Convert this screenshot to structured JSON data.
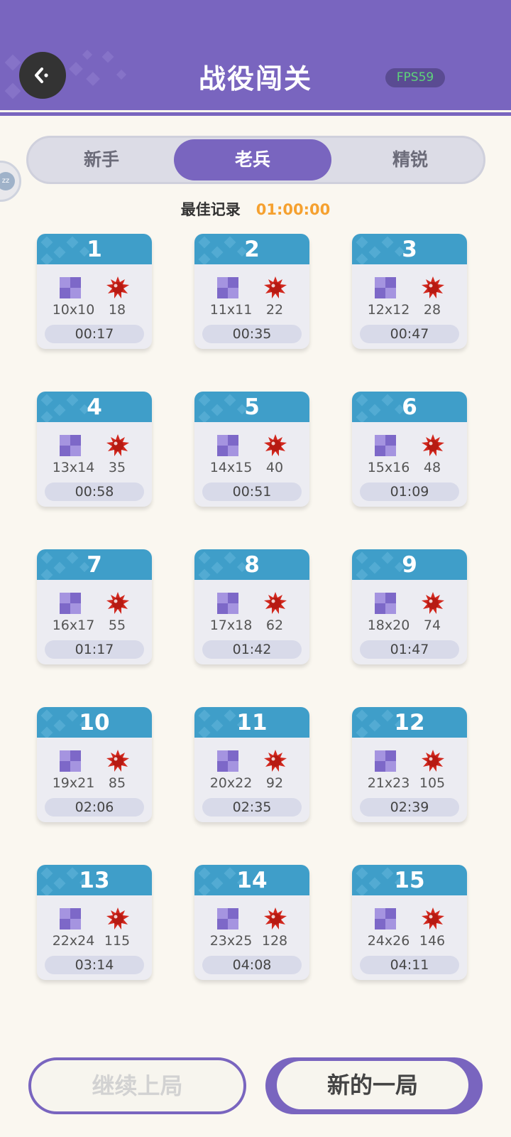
{
  "header": {
    "title": "战役闯关",
    "fps": "FPS59",
    "back_icon": "back-arrow-icon"
  },
  "colors": {
    "primary": "#7965bf",
    "card_header": "#3f9ec9",
    "best_time": "#f5a130",
    "fps_text": "#5ed37a",
    "mine": "#d1281e"
  },
  "tabs": [
    {
      "label": "新手",
      "active": false
    },
    {
      "label": "老兵",
      "active": true
    },
    {
      "label": "精锐",
      "active": false
    }
  ],
  "best": {
    "label": "最佳记录",
    "value": "01:00:00"
  },
  "levels": [
    {
      "num": "1",
      "size": "10x10",
      "mines": "18",
      "time": "00:17"
    },
    {
      "num": "2",
      "size": "11x11",
      "mines": "22",
      "time": "00:35"
    },
    {
      "num": "3",
      "size": "12x12",
      "mines": "28",
      "time": "00:47"
    },
    {
      "num": "4",
      "size": "13x14",
      "mines": "35",
      "time": "00:58"
    },
    {
      "num": "5",
      "size": "14x15",
      "mines": "40",
      "time": "00:51"
    },
    {
      "num": "6",
      "size": "15x16",
      "mines": "48",
      "time": "01:09"
    },
    {
      "num": "7",
      "size": "16x17",
      "mines": "55",
      "time": "01:17"
    },
    {
      "num": "8",
      "size": "17x18",
      "mines": "62",
      "time": "01:42"
    },
    {
      "num": "9",
      "size": "18x20",
      "mines": "74",
      "time": "01:47"
    },
    {
      "num": "10",
      "size": "19x21",
      "mines": "85",
      "time": "02:06"
    },
    {
      "num": "11",
      "size": "20x22",
      "mines": "92",
      "time": "02:35"
    },
    {
      "num": "12",
      "size": "21x23",
      "mines": "105",
      "time": "02:39"
    },
    {
      "num": "13",
      "size": "22x24",
      "mines": "115",
      "time": "03:14"
    },
    {
      "num": "14",
      "size": "23x25",
      "mines": "128",
      "time": "04:08"
    },
    {
      "num": "15",
      "size": "24x26",
      "mines": "146",
      "time": "04:11"
    }
  ],
  "buttons": {
    "continue_label": "继续上局",
    "new_label": "新的一局"
  }
}
